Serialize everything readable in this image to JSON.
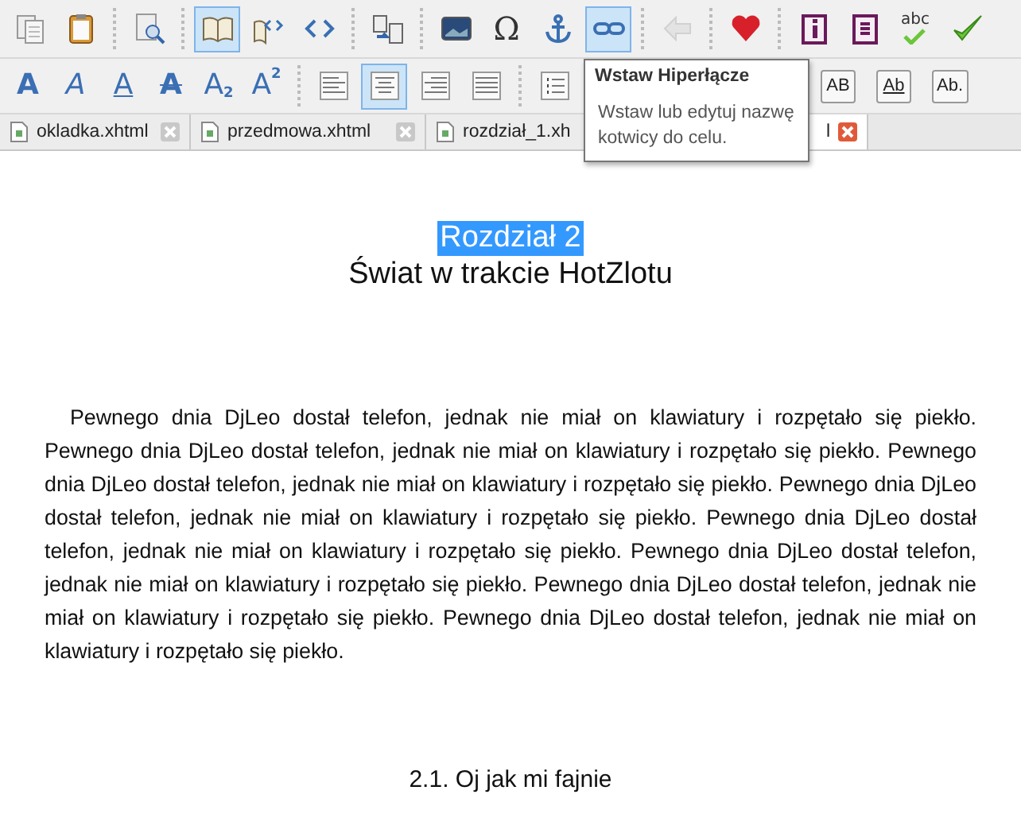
{
  "toolbar_main": [
    {
      "kind": "button",
      "selected": false,
      "disabled": false
    },
    {
      "kind": "button",
      "selected": false,
      "disabled": false
    },
    {
      "kind": "separator"
    },
    {
      "kind": "button",
      "selected": false,
      "disabled": false
    },
    {
      "kind": "separator"
    },
    {
      "kind": "button",
      "selected": true,
      "disabled": false
    },
    {
      "kind": "button",
      "selected": false,
      "disabled": false
    },
    {
      "kind": "button",
      "selected": false,
      "disabled": false
    },
    {
      "kind": "separator"
    },
    {
      "kind": "button",
      "selected": false,
      "disabled": false
    },
    {
      "kind": "separator"
    },
    {
      "kind": "button",
      "selected": false,
      "disabled": false
    },
    {
      "kind": "glyph",
      "text": "Ω",
      "selected": false,
      "disabled": false
    },
    {
      "kind": "button",
      "selected": false,
      "disabled": false
    },
    {
      "kind": "button",
      "selected": true,
      "disabled": false
    },
    {
      "kind": "separator"
    },
    {
      "kind": "button",
      "selected": false,
      "disabled": true
    },
    {
      "kind": "separator"
    },
    {
      "kind": "button",
      "selected": false,
      "disabled": false
    },
    {
      "kind": "separator"
    },
    {
      "kind": "button",
      "selected": false,
      "disabled": false
    },
    {
      "kind": "button",
      "selected": false,
      "disabled": false
    },
    {
      "kind": "spell",
      "text": "abc",
      "selected": false,
      "disabled": false
    },
    {
      "kind": "button",
      "selected": false,
      "disabled": false
    }
  ],
  "toolbar_format": [
    {
      "kind": "format",
      "text": "A",
      "selected": false
    },
    {
      "kind": "format",
      "text": "A",
      "selected": false
    },
    {
      "kind": "format",
      "text": "A",
      "selected": false
    },
    {
      "kind": "format",
      "text": "A",
      "selected": false
    },
    {
      "kind": "format",
      "text": "A",
      "index": "2",
      "selected": false
    },
    {
      "kind": "format",
      "text": "A",
      "index": "2",
      "selected": false
    },
    {
      "kind": "separator"
    },
    {
      "kind": "align",
      "selected": false
    },
    {
      "kind": "align",
      "selected": true
    },
    {
      "kind": "align",
      "selected": false
    },
    {
      "kind": "align",
      "selected": false
    },
    {
      "kind": "separator"
    },
    {
      "kind": "bullets",
      "selected": false
    },
    {
      "kind": "case",
      "text": "AB",
      "selected": false
    },
    {
      "kind": "case",
      "text": "Ab",
      "selected": false
    },
    {
      "kind": "case",
      "text": "Ab.",
      "selected": false
    }
  ],
  "tabs": [
    {
      "label": "okladka.xhtml",
      "selected": false
    },
    {
      "label": "przedmowa.xhtml",
      "selected": false
    },
    {
      "label": "rozdział_1.xh",
      "selected": false
    },
    {
      "label": "l",
      "selected": true
    }
  ],
  "tooltip": {
    "title": "Wstaw Hiperłącze",
    "body": "Wstaw lub edytuj nazwę kotwicy do celu."
  },
  "document": {
    "chapter_label": {
      "text": "Rozdział 2",
      "selected": true
    },
    "title": "Świat w trakcie HotZlotu",
    "paragraph": "Pewnego dnia DjLeo dostał telefon, jednak nie miał on klawiatury i rozpętało się piekło. Pewnego dnia DjLeo dostał telefon, jednak nie miał on klawiatury i rozpętało się piekło. Pewnego dnia DjLeo dostał telefon, jednak nie miał on klawiatury i rozpętało się piekło. Pewnego dnia DjLeo dostał telefon, jednak nie miał on klawiatury i rozpętało się piekło. Pewnego dnia DjLeo dostał telefon, jednak nie miał on klawiatury i rozpętało się piekło. Pewnego dnia DjLeo dostał telefon, jednak nie miał on klawiatury i rozpętało się piekło. Pewnego dnia DjLeo dostał telefon, jednak nie miał on klawiatury i rozpętało się piekło. Pewnego dnia DjLeo dostał telefon, jednak nie miał on klawiatury i rozpętało się piekło.",
    "section_heading": "2.1. Oj jak mi fajnie"
  }
}
